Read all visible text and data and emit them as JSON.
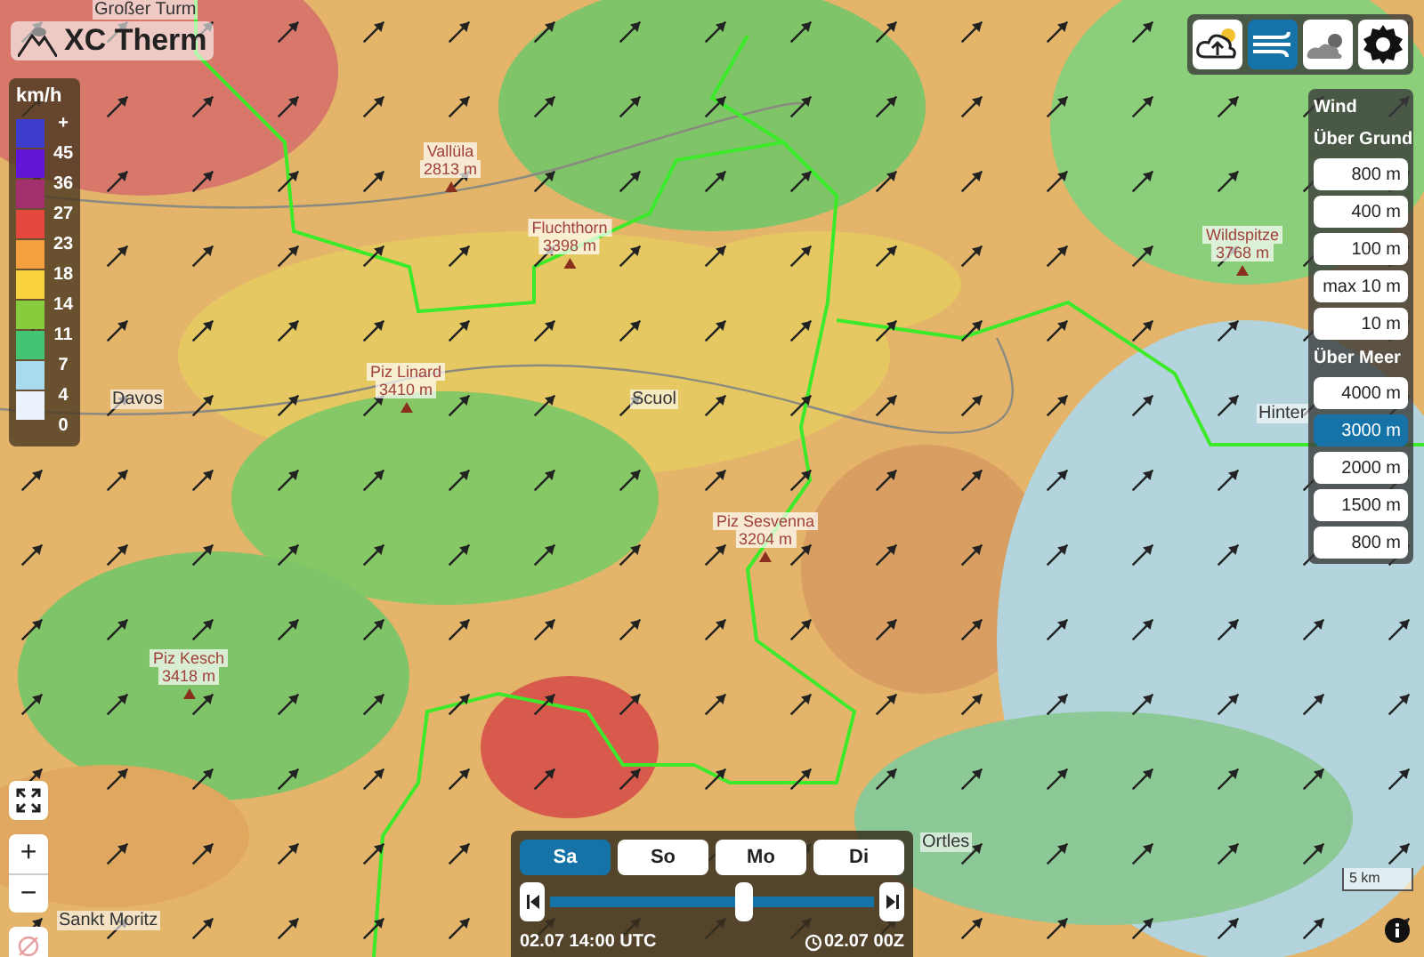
{
  "app": {
    "title": "XC Therm"
  },
  "legend": {
    "unit": "km/h",
    "top_label": "+",
    "steps": [
      {
        "label": "45",
        "color": "#3b3bcc"
      },
      {
        "label": "36",
        "color": "#6216d6"
      },
      {
        "label": "27",
        "color": "#a3306e"
      },
      {
        "label": "23",
        "color": "#e4473b"
      },
      {
        "label": "18",
        "color": "#f5a040"
      },
      {
        "label": "14",
        "color": "#f7d23e"
      },
      {
        "label": "11",
        "color": "#86cc3c"
      },
      {
        "label": "7",
        "color": "#43c472"
      },
      {
        "label": "4",
        "color": "#a9dbf0"
      },
      {
        "label": "0",
        "color": "#eaf2fb"
      }
    ]
  },
  "map_labels": [
    {
      "kind": "place",
      "text": "Großer Turm"
    },
    {
      "kind": "peak",
      "text": "Vallüla",
      "sub": "2813 m"
    },
    {
      "kind": "peak",
      "text": "Fluchthorn",
      "sub": "3398 m"
    },
    {
      "kind": "peak",
      "text": "Wildspitze",
      "sub": "3768 m"
    },
    {
      "kind": "place",
      "text": "Davos"
    },
    {
      "kind": "peak",
      "text": "Piz Linard",
      "sub": "3410 m"
    },
    {
      "kind": "place",
      "text": "Scuol"
    },
    {
      "kind": "place",
      "text": "Hinter"
    },
    {
      "kind": "peak",
      "text": "Piz Sesvenna",
      "sub": "3204 m"
    },
    {
      "kind": "peak",
      "text": "Piz Kesch",
      "sub": "3418 m"
    },
    {
      "kind": "place",
      "text": "Ortles"
    },
    {
      "kind": "place",
      "text": "Sankt Moritz"
    }
  ],
  "layer_buttons": [
    {
      "kind": "thermal",
      "selected": false
    },
    {
      "kind": "wind",
      "selected": true
    },
    {
      "kind": "weather",
      "selected": false
    },
    {
      "kind": "settings",
      "selected": false
    }
  ],
  "wind_panel": {
    "title": "Wind",
    "groups": [
      {
        "heading": "Über Grund",
        "options": [
          {
            "label": "800 m",
            "selected": false
          },
          {
            "label": "400 m",
            "selected": false
          },
          {
            "label": "100 m",
            "selected": false
          },
          {
            "label": "max 10 m",
            "selected": false
          },
          {
            "label": "10 m",
            "selected": false
          }
        ]
      },
      {
        "heading": "Über Meer",
        "options": [
          {
            "label": "4000 m",
            "selected": false
          },
          {
            "label": "3000 m",
            "selected": true
          },
          {
            "label": "2000 m",
            "selected": false
          },
          {
            "label": "1500 m",
            "selected": false
          },
          {
            "label": "800 m",
            "selected": false
          }
        ]
      }
    ]
  },
  "zoom_controls": {
    "zoom_in": "+",
    "zoom_out": "−"
  },
  "time_panel": {
    "days": [
      {
        "label": "Sa",
        "selected": true
      },
      {
        "label": "So",
        "selected": false
      },
      {
        "label": "Mo",
        "selected": false
      },
      {
        "label": "Di",
        "selected": false
      }
    ],
    "slider": {
      "level": 0.6
    },
    "time": "02.07 14:00 UTC",
    "run": "02.07 00Z"
  },
  "scale": "5 km"
}
